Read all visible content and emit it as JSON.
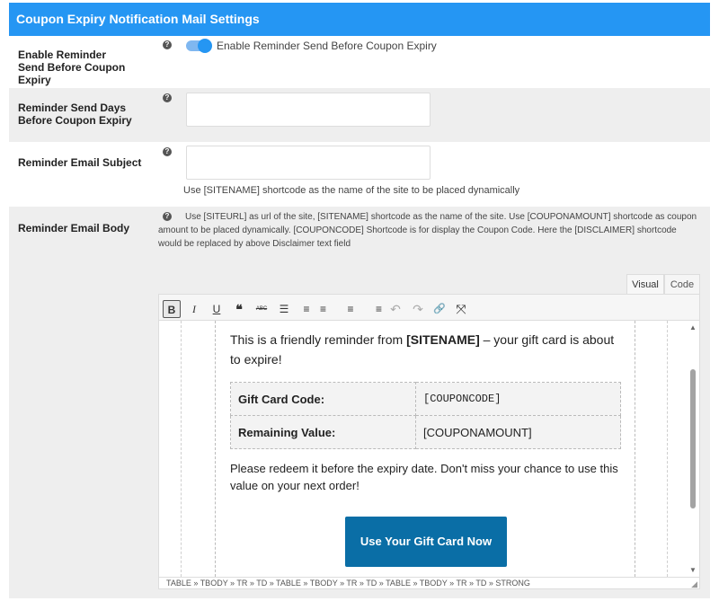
{
  "header": {
    "title": "Coupon Expiry Notification Mail Settings"
  },
  "settings": {
    "enable": {
      "label": "Enable Reminder Send Before Coupon Expiry",
      "toggle_label": "Enable Reminder Send Before Coupon Expiry",
      "enabled": true
    },
    "days": {
      "label": "Reminder Send Days Before Coupon Expiry",
      "value": ""
    },
    "subject": {
      "label": "Reminder Email Subject",
      "value": "",
      "hint": "Use [SITENAME] shortcode as the name of the site to be placed dynamically"
    },
    "body": {
      "label": "Reminder Email Body",
      "hint": "Use [SITEURL] as url of the site, [SITENAME] shortcode as the name of the site. Use [COUPONAMOUNT] shortcode as coupon amount to be placed dynamically. [COUPONCODE] Shortcode is for display the Coupon Code. Here the [DISCLAIMER] shortcode would be replaced by above Disclaimer text field"
    }
  },
  "help_icon": "?",
  "editor": {
    "tabs": [
      "Visual",
      "Code"
    ],
    "active_tab": "Visual",
    "toolbar": [
      {
        "name": "bold",
        "glyph": "B"
      },
      {
        "name": "italic",
        "glyph": "I"
      },
      {
        "name": "underline",
        "glyph": "U"
      },
      {
        "name": "blockquote",
        "glyph": "❝"
      },
      {
        "name": "strikethrough",
        "glyph": "ABC"
      },
      {
        "name": "bullet-list",
        "glyph": "☰"
      },
      {
        "name": "numbered-list",
        "glyph": "≡"
      },
      {
        "name": "align-left",
        "glyph": "≡"
      },
      {
        "name": "align-center",
        "glyph": "≡"
      },
      {
        "name": "align-right",
        "glyph": "≡"
      },
      {
        "name": "undo",
        "glyph": "↶"
      },
      {
        "name": "redo",
        "glyph": "↷"
      },
      {
        "name": "link",
        "glyph": "🔗"
      },
      {
        "name": "fullscreen",
        "glyph": "⤧"
      }
    ],
    "content": {
      "intro_before": "This is a friendly reminder from ",
      "intro_bold": "[SITENAME]",
      "intro_after": " – your gift card is about to expire!",
      "table": [
        {
          "label": "Gift Card Code:",
          "value": "[COUPONCODE]"
        },
        {
          "label": "Remaining Value:",
          "value": "[COUPONAMOUNT]"
        }
      ],
      "redeem": "Please redeem it before the expiry date. Don't miss your chance to use this value on your next order!",
      "cta_label": "Use Your Gift Card Now"
    },
    "statusbar": "TABLE » TBODY » TR » TD » TABLE » TBODY » TR » TD » TABLE » TBODY » TR » TD » STRONG"
  },
  "colors": {
    "header": "#2596f3",
    "toggle": "#2596f3",
    "cta": "#0a6ea6"
  }
}
